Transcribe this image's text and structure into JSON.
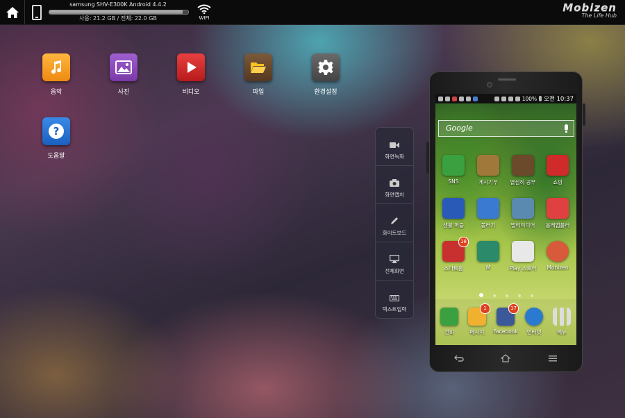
{
  "topbar": {
    "device_name": "samsung SHV-E300K Android 4.4.2",
    "storage_text": "사용: 21.2 GB / 전체: 22.0 GB",
    "storage_used_fraction": 0.96,
    "wifi_label": "WIFI",
    "brand_name": "Mobizen",
    "brand_tagline": "The Life Hub"
  },
  "desktop_apps": [
    {
      "label": "음악",
      "icon": "music-note-icon",
      "color": "#f39a1e"
    },
    {
      "label": "사진",
      "icon": "photo-icon",
      "color": "#8c48b8"
    },
    {
      "label": "비디오",
      "icon": "play-icon",
      "color": "#d42a2a"
    },
    {
      "label": "파일",
      "icon": "folder-icon",
      "color": "#6b4a2a"
    },
    {
      "label": "환경설정",
      "icon": "gear-icon",
      "color": "#5a5a5a"
    },
    {
      "label": "도움말",
      "icon": "help-icon",
      "color": "#2a7ad8"
    }
  ],
  "tools": [
    {
      "label": "화면녹화",
      "icon": "video-camera-icon"
    },
    {
      "label": "화면캡처",
      "icon": "camera-icon"
    },
    {
      "label": "화이트보드",
      "icon": "pencil-icon"
    },
    {
      "label": "전체화면",
      "icon": "monitor-icon"
    },
    {
      "label": "텍스트입력",
      "icon": "keyboard-icon"
    }
  ],
  "phone": {
    "status": {
      "battery": "100%",
      "time": "오전 10:37"
    },
    "search_label": "Google",
    "apps": [
      {
        "label": "SNS",
        "color": "#3aa040",
        "badge": ""
      },
      {
        "label": "게시기우",
        "color": "#a0783a",
        "badge": ""
      },
      {
        "label": "열심히 공부",
        "color": "#6a4a2a",
        "badge": ""
      },
      {
        "label": "쇼핑",
        "color": "#d02a2a",
        "badge": ""
      },
      {
        "label": "생활 퍼즐",
        "color": "#2a5ab8",
        "badge": ""
      },
      {
        "label": "볼러기",
        "color": "#3a7ad0",
        "badge": ""
      },
      {
        "label": "멀티미디어",
        "color": "#5a8ab0",
        "badge": ""
      },
      {
        "label": "올레앱플러",
        "color": "#e04040",
        "badge": ""
      },
      {
        "label": "스마트홈",
        "color": "#c83030",
        "badge": "18"
      },
      {
        "label": "M",
        "color": "#2a8a6a",
        "badge": ""
      },
      {
        "label": "Play 스토어",
        "color": "#e8e8e8",
        "badge": ""
      },
      {
        "label": "Mobizen",
        "color": "#d85a3a",
        "badge": ""
      }
    ],
    "dock": [
      {
        "label": "전화",
        "color": "#3aa040",
        "badge": ""
      },
      {
        "label": "메시지",
        "color": "#f0b030",
        "badge": "1"
      },
      {
        "label": "Facebook",
        "color": "#3b5998",
        "badge": "17"
      },
      {
        "label": "인터넷",
        "color": "#2a7ad0",
        "badge": ""
      },
      {
        "label": "메뉴",
        "color": "#cccccc",
        "badge": ""
      }
    ]
  }
}
